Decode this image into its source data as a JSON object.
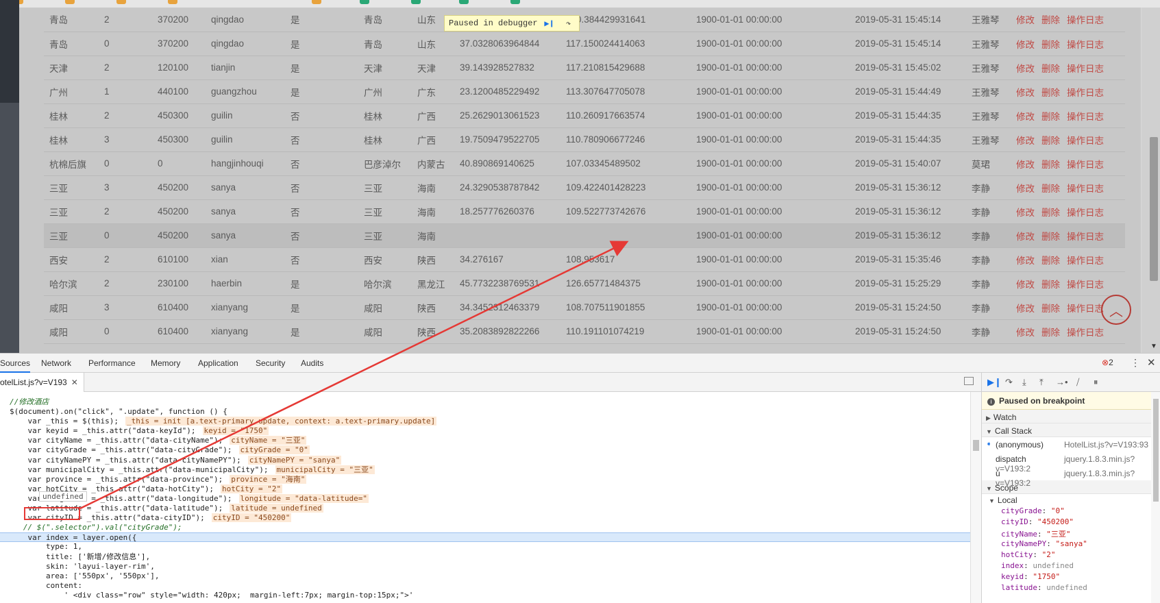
{
  "table": {
    "rows": [
      {
        "city": "青岛",
        "grade": "2",
        "code": "370200",
        "pinyin": "qingdao",
        "hot": "是",
        "municipal": "青岛",
        "province": "山东",
        "latitude": "",
        "longitude": "120.384429931641",
        "date1": "1900-01-01 00:00:00",
        "date2": "2019-05-31 15:45:14",
        "user": "王雅琴"
      },
      {
        "city": "青岛",
        "grade": "0",
        "code": "370200",
        "pinyin": "qingdao",
        "hot": "是",
        "municipal": "青岛",
        "province": "山东",
        "latitude": "37.0328063964844",
        "longitude": "117.150024414063",
        "date1": "1900-01-01 00:00:00",
        "date2": "2019-05-31 15:45:14",
        "user": "王雅琴"
      },
      {
        "city": "天津",
        "grade": "2",
        "code": "120100",
        "pinyin": "tianjin",
        "hot": "是",
        "municipal": "天津",
        "province": "天津",
        "latitude": "39.143928527832",
        "longitude": "117.210815429688",
        "date1": "1900-01-01 00:00:00",
        "date2": "2019-05-31 15:45:02",
        "user": "王雅琴"
      },
      {
        "city": "广州",
        "grade": "1",
        "code": "440100",
        "pinyin": "guangzhou",
        "hot": "是",
        "municipal": "广州",
        "province": "广东",
        "latitude": "23.1200485229492",
        "longitude": "113.307647705078",
        "date1": "1900-01-01 00:00:00",
        "date2": "2019-05-31 15:44:49",
        "user": "王雅琴"
      },
      {
        "city": "桂林",
        "grade": "2",
        "code": "450300",
        "pinyin": "guilin",
        "hot": "否",
        "municipal": "桂林",
        "province": "广西",
        "latitude": "25.2629013061523",
        "longitude": "110.260917663574",
        "date1": "1900-01-01 00:00:00",
        "date2": "2019-05-31 15:44:35",
        "user": "王雅琴"
      },
      {
        "city": "桂林",
        "grade": "3",
        "code": "450300",
        "pinyin": "guilin",
        "hot": "否",
        "municipal": "桂林",
        "province": "广西",
        "latitude": "19.7509479522705",
        "longitude": "110.780906677246",
        "date1": "1900-01-01 00:00:00",
        "date2": "2019-05-31 15:44:35",
        "user": "王雅琴"
      },
      {
        "city": "杭棉后旗",
        "grade": "0",
        "code": "0",
        "pinyin": "hangjinhouqi",
        "hot": "否",
        "municipal": "巴彦淖尔",
        "province": "内蒙古",
        "latitude": "40.890869140625",
        "longitude": "107.03345489502",
        "date1": "1900-01-01 00:00:00",
        "date2": "2019-05-31 15:40:07",
        "user": "莫珺"
      },
      {
        "city": "三亚",
        "grade": "3",
        "code": "450200",
        "pinyin": "sanya",
        "hot": "否",
        "municipal": "三亚",
        "province": "海南",
        "latitude": "24.3290538787842",
        "longitude": "109.422401428223",
        "date1": "1900-01-01 00:00:00",
        "date2": "2019-05-31 15:36:12",
        "user": "李静"
      },
      {
        "city": "三亚",
        "grade": "2",
        "code": "450200",
        "pinyin": "sanya",
        "hot": "否",
        "municipal": "三亚",
        "province": "海南",
        "latitude": "18.257776260376",
        "longitude": "109.522773742676",
        "date1": "1900-01-01 00:00:00",
        "date2": "2019-05-31 15:36:12",
        "user": "李静"
      },
      {
        "city": "三亚",
        "grade": "0",
        "code": "450200",
        "pinyin": "sanya",
        "hot": "否",
        "municipal": "三亚",
        "province": "海南",
        "latitude": "",
        "longitude": "",
        "date1": "1900-01-01 00:00:00",
        "date2": "2019-05-31 15:36:12",
        "user": "李静"
      },
      {
        "city": "西安",
        "grade": "2",
        "code": "610100",
        "pinyin": "xian",
        "hot": "否",
        "municipal": "西安",
        "province": "陕西",
        "latitude": "34.276167",
        "longitude": "108.953617",
        "date1": "1900-01-01 00:00:00",
        "date2": "2019-05-31 15:35:46",
        "user": "李静"
      },
      {
        "city": "哈尔滨",
        "grade": "2",
        "code": "230100",
        "pinyin": "haerbin",
        "hot": "是",
        "municipal": "哈尔滨",
        "province": "黑龙江",
        "latitude": "45.7732238769531",
        "longitude": "126.65771484375",
        "date1": "1900-01-01 00:00:00",
        "date2": "2019-05-31 15:25:29",
        "user": "李静"
      },
      {
        "city": "咸阳",
        "grade": "3",
        "code": "610400",
        "pinyin": "xianyang",
        "hot": "是",
        "municipal": "咸阳",
        "province": "陕西",
        "latitude": "34.3452312463379",
        "longitude": "108.707511901855",
        "date1": "1900-01-01 00:00:00",
        "date2": "2019-05-31 15:24:50",
        "user": "李静"
      },
      {
        "city": "咸阳",
        "grade": "0",
        "code": "610400",
        "pinyin": "xianyang",
        "hot": "是",
        "municipal": "咸阳",
        "province": "陕西",
        "latitude": "35.2083892822266",
        "longitude": "110.191101074219",
        "date1": "1900-01-01 00:00:00",
        "date2": "2019-05-31 15:24:50",
        "user": "李静"
      }
    ],
    "highlight_row": 9,
    "actions": {
      "edit": "修改",
      "delete": "删除",
      "log": "操作日志"
    }
  },
  "paused_banner": {
    "text": "Paused in debugger"
  },
  "devtools": {
    "tabs": [
      "Sources",
      "Network",
      "Performance",
      "Memory",
      "Application",
      "Security",
      "Audits"
    ],
    "active_tab": "Sources",
    "error_count": "2",
    "file_tab": "otelList.js?v=V193",
    "code_lines": [
      {
        "cls": "cmt",
        "text": "//修改酒店",
        "inline": ""
      },
      {
        "cls": "",
        "text": "$(document).on(\"click\", \".update\", function () {",
        "inline": ""
      },
      {
        "cls": "",
        "text": "    var _this = $(this);",
        "inline": "_this = init [a.text-primary.update, context: a.text-primary.update]"
      },
      {
        "cls": "",
        "text": "    var keyid = _this.attr(\"data-keyId\");",
        "inline": "keyid = \"1750\""
      },
      {
        "cls": "",
        "text": "    var cityName = _this.attr(\"data-cityName\");",
        "inline": "cityName = \"三亚\""
      },
      {
        "cls": "",
        "text": "    var cityGrade = _this.attr(\"data-cityGrade\");",
        "inline": "cityGrade = \"0\""
      },
      {
        "cls": "",
        "text": "    var cityNamePY = _this.attr(\"data-cityNamePY\");",
        "inline": "cityNamePY = \"sanya\""
      },
      {
        "cls": "",
        "text": "    var municipalCity = _this.attr(\"data-municipalCity\");",
        "inline": "municipalCity = \"三亚\""
      },
      {
        "cls": "",
        "text": "    var province = _this.attr(\"data-province\");",
        "inline": "province = \"海南\""
      },
      {
        "cls": "",
        "text": "    var hotCity = _this.attr(\"data-hotCity\");",
        "inline": "hotCity = \"2\""
      },
      {
        "cls": "",
        "text": "    var longitude = _this.attr(\"data-longitude\");",
        "inline": "longitude = \"data-latitude=\""
      },
      {
        "cls": "",
        "text": "    var latitude = _this.attr(\"data-latitude\");",
        "inline": "latitude = undefined"
      },
      {
        "cls": "",
        "text": "    var cityID = _this.attr(\"data-cityID\");",
        "inline": "cityID = \"450200\""
      },
      {
        "cls": "cmt",
        "text": "   // $(\".selector\").val(\"cityGrade\");",
        "inline": ""
      },
      {
        "cls": "hl",
        "text": "    var index = layer.open({",
        "inline": ""
      },
      {
        "cls": "",
        "text": "        type: 1,",
        "inline": ""
      },
      {
        "cls": "",
        "text": "        title: ['新增/修改信息'],",
        "inline": ""
      },
      {
        "cls": "",
        "text": "        skin: 'layui-layer-rim',",
        "inline": ""
      },
      {
        "cls": "",
        "text": "        area: ['550px', '550px'],",
        "inline": ""
      },
      {
        "cls": "",
        "text": "        content:",
        "inline": ""
      },
      {
        "cls": "",
        "text": "            ' <div class=\"row\" style=\"width: 420px;  margin-left:7px; margin-top:15px;\">'",
        "inline": ""
      }
    ],
    "tooltip": "undefined",
    "paused_on": "Paused on breakpoint",
    "sections": {
      "watch": "Watch",
      "call_stack": "Call Stack",
      "scope": "Scope",
      "local": "Local"
    },
    "call_stack": [
      {
        "fn": "(anonymous)",
        "loc": "HotelList.js?v=V193:93",
        "current": true
      },
      {
        "fn": "dispatch",
        "loc": "jquery.1.8.3.min.js?v=V193:2",
        "current": false
      },
      {
        "fn": "u",
        "loc": "jquery.1.8.3.min.js?v=V193:2",
        "current": false
      }
    ],
    "scope_local": [
      {
        "k": "cityGrade",
        "v": "\"0\""
      },
      {
        "k": "cityID",
        "v": "\"450200\""
      },
      {
        "k": "cityName",
        "v": "\"三亚\""
      },
      {
        "k": "cityNamePY",
        "v": "\"sanya\""
      },
      {
        "k": "hotCity",
        "v": "\"2\""
      },
      {
        "k": "index",
        "v": "undefined"
      },
      {
        "k": "keyid",
        "v": "\"1750\""
      },
      {
        "k": "latitude",
        "v": "undefined"
      }
    ]
  },
  "colors": {
    "accent": "#1a73e8",
    "annotation": "#e53935",
    "action": "#c04a45"
  }
}
